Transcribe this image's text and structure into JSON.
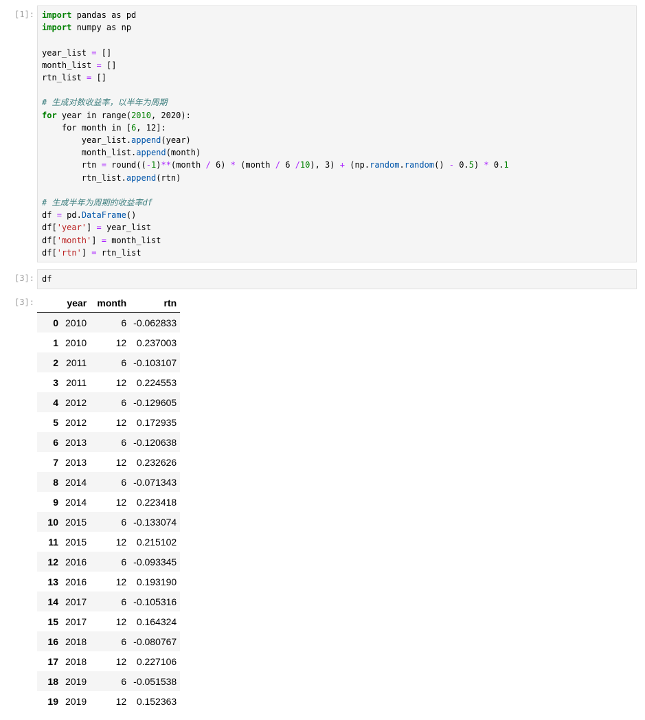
{
  "cells": [
    {
      "prompt": "[1]:"
    },
    {
      "prompt": "[3]:",
      "code": "df"
    }
  ],
  "output": {
    "prompt": "[3]:",
    "columns": [
      "",
      "year",
      "month",
      "rtn"
    ],
    "rows": [
      [
        "0",
        "2010",
        "6",
        "-0.062833"
      ],
      [
        "1",
        "2010",
        "12",
        "0.237003"
      ],
      [
        "2",
        "2011",
        "6",
        "-0.103107"
      ],
      [
        "3",
        "2011",
        "12",
        "0.224553"
      ],
      [
        "4",
        "2012",
        "6",
        "-0.129605"
      ],
      [
        "5",
        "2012",
        "12",
        "0.172935"
      ],
      [
        "6",
        "2013",
        "6",
        "-0.120638"
      ],
      [
        "7",
        "2013",
        "12",
        "0.232626"
      ],
      [
        "8",
        "2014",
        "6",
        "-0.071343"
      ],
      [
        "9",
        "2014",
        "12",
        "0.223418"
      ],
      [
        "10",
        "2015",
        "6",
        "-0.133074"
      ],
      [
        "11",
        "2015",
        "12",
        "0.215102"
      ],
      [
        "12",
        "2016",
        "6",
        "-0.093345"
      ],
      [
        "13",
        "2016",
        "12",
        "0.193190"
      ],
      [
        "14",
        "2017",
        "6",
        "-0.105316"
      ],
      [
        "15",
        "2017",
        "12",
        "0.164324"
      ],
      [
        "16",
        "2018",
        "6",
        "-0.080767"
      ],
      [
        "17",
        "2018",
        "12",
        "0.227106"
      ],
      [
        "18",
        "2019",
        "6",
        "-0.051538"
      ],
      [
        "19",
        "2019",
        "12",
        "0.152363"
      ]
    ]
  },
  "code1_lines": [
    "import pandas as pd",
    "import numpy as np",
    "",
    "year_list = []",
    "month_list = []",
    "rtn_list = []",
    "",
    "# 生成对数收益率，以半年为周期",
    "for year in range(2010, 2020):",
    "    for month in [6, 12]:",
    "        year_list.append(year)",
    "        month_list.append(month)",
    "        rtn = round((-1)**(month / 6) * (month / 6 /10), 3) + (np.random.random() - 0.5) * 0.1",
    "        rtn_list.append(rtn)",
    "",
    "# 生成半年为周期的收益率df",
    "df = pd.DataFrame()",
    "df['year'] = year_list",
    "df['month'] = month_list",
    "df['rtn'] = rtn_list"
  ]
}
